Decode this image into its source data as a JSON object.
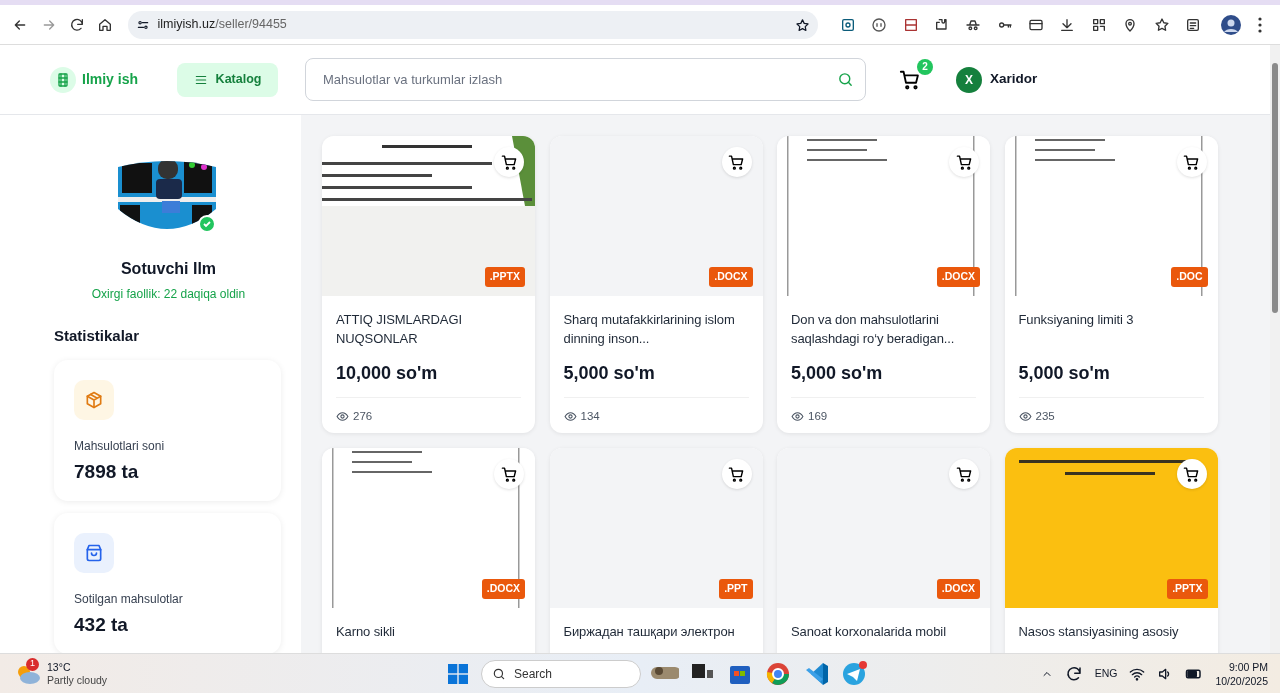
{
  "browser": {
    "url_host": "ilmiyish.uz",
    "url_path": "/seller/94455"
  },
  "header": {
    "logo": "Ilmiy ish",
    "catalog_button": "Katalog",
    "search": {
      "placeholder": "Mahsulotlar va turkumlar izlash"
    },
    "cart_count": "2",
    "user": {
      "initial": "X",
      "name": "Xaridor"
    }
  },
  "seller": {
    "name": "Sotuvchi Ilm",
    "verified": true,
    "last_active": "Oxirgi faollik: 22 daqiqa oldin"
  },
  "stats": {
    "title": "Statistikalar",
    "items": [
      {
        "kind": "products",
        "label": "Mahsulotlari soni",
        "value": "7898 ta"
      },
      {
        "kind": "sold",
        "label": "Sotilgan mahsulotlar",
        "value": "432 ta"
      }
    ]
  },
  "products": [
    {
      "format": ".PPTX",
      "title": "ATTIQ JISMLARDAGI NUQSONLAR",
      "price": "10,000 so'm",
      "views": "276"
    },
    {
      "format": ".DOCX",
      "title": "Sharq mutafakkirlarining islom dinning inson...",
      "price": "5,000 so'm",
      "views": "134"
    },
    {
      "format": ".DOCX",
      "title": "Don va don mahsulotlarini saqlashdagi ro‘y beradigan...",
      "price": "5,000 so'm",
      "views": "169"
    },
    {
      "format": ".DOC",
      "title": "Funksiyaning limiti 3",
      "price": "5,000 so'm",
      "views": "235"
    },
    {
      "format": ".DOCX",
      "title": "Karno sikli"
    },
    {
      "format": ".PPT",
      "title": "Биржадан ташқари электрон"
    },
    {
      "format": ".DOCX",
      "title": "Sanoat korxonalarida mobil"
    },
    {
      "format": ".PPTX",
      "title": "Nasos stansiyasining asosiy"
    }
  ],
  "taskbar": {
    "weather": {
      "badge": "1",
      "temperature": "13°C",
      "condition": "Partly cloudy"
    },
    "search": "Search",
    "language": "ENG",
    "time": "9:00 PM",
    "date": "10/20/2025"
  }
}
